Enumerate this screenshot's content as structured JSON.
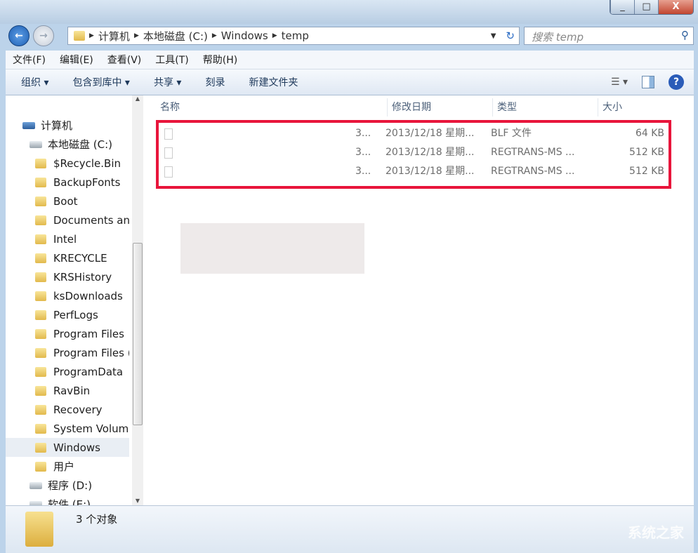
{
  "window": {
    "minimize": "_",
    "maximize": "□",
    "close": "X"
  },
  "nav": {
    "back": "←",
    "forward": "→",
    "breadcrumb": [
      "计算机",
      "本地磁盘 (C:)",
      "Windows",
      "temp"
    ],
    "search_placeholder": "搜索 temp",
    "refresh": "↻"
  },
  "menu": [
    "文件(F)",
    "编辑(E)",
    "查看(V)",
    "工具(T)",
    "帮助(H)"
  ],
  "toolbar": {
    "organize": "组织 ▾",
    "include_library": "包含到库中 ▾",
    "share": "共享 ▾",
    "burn": "刻录",
    "new_folder": "新建文件夹",
    "views": "☰ ▾",
    "help": "?"
  },
  "tree": [
    {
      "label": "计算机",
      "type": "computer"
    },
    {
      "label": "本地磁盘 (C:)",
      "type": "drive"
    },
    {
      "label": "$Recycle.Bin",
      "type": "folder"
    },
    {
      "label": "BackupFonts",
      "type": "folder"
    },
    {
      "label": "Boot",
      "type": "folder"
    },
    {
      "label": "Documents and",
      "type": "folder"
    },
    {
      "label": "Intel",
      "type": "folder"
    },
    {
      "label": "KRECYCLE",
      "type": "folder"
    },
    {
      "label": "KRSHistory",
      "type": "folder"
    },
    {
      "label": "ksDownloads",
      "type": "folder"
    },
    {
      "label": "PerfLogs",
      "type": "folder"
    },
    {
      "label": "Program Files",
      "type": "folder"
    },
    {
      "label": "Program Files (",
      "type": "folder"
    },
    {
      "label": "ProgramData",
      "type": "folder"
    },
    {
      "label": "RavBin",
      "type": "folder"
    },
    {
      "label": "Recovery",
      "type": "folder"
    },
    {
      "label": "System Volume",
      "type": "folder"
    },
    {
      "label": "Windows",
      "type": "folder",
      "selected": true
    },
    {
      "label": "用户",
      "type": "folder"
    },
    {
      "label": "程序 (D:)",
      "type": "drive"
    },
    {
      "label": "软件 (E:)",
      "type": "drive"
    }
  ],
  "columns": {
    "name": "名称",
    "modified": "修改日期",
    "type": "类型",
    "size": "大小"
  },
  "files": [
    {
      "name_suffix": "3...",
      "modified": "2013/12/18 星期...",
      "type": "BLF 文件",
      "size": "64 KB"
    },
    {
      "name_suffix": "3...",
      "modified": "2013/12/18 星期...",
      "type": "REGTRANS-MS ...",
      "size": "512 KB"
    },
    {
      "name_suffix": "3...",
      "modified": "2013/12/18 星期...",
      "type": "REGTRANS-MS ...",
      "size": "512 KB"
    }
  ],
  "status": {
    "count": "3 个对象"
  },
  "watermark": "系统之家",
  "colors": {
    "highlight": "#e8153b",
    "accent": "#1d5fb3"
  }
}
